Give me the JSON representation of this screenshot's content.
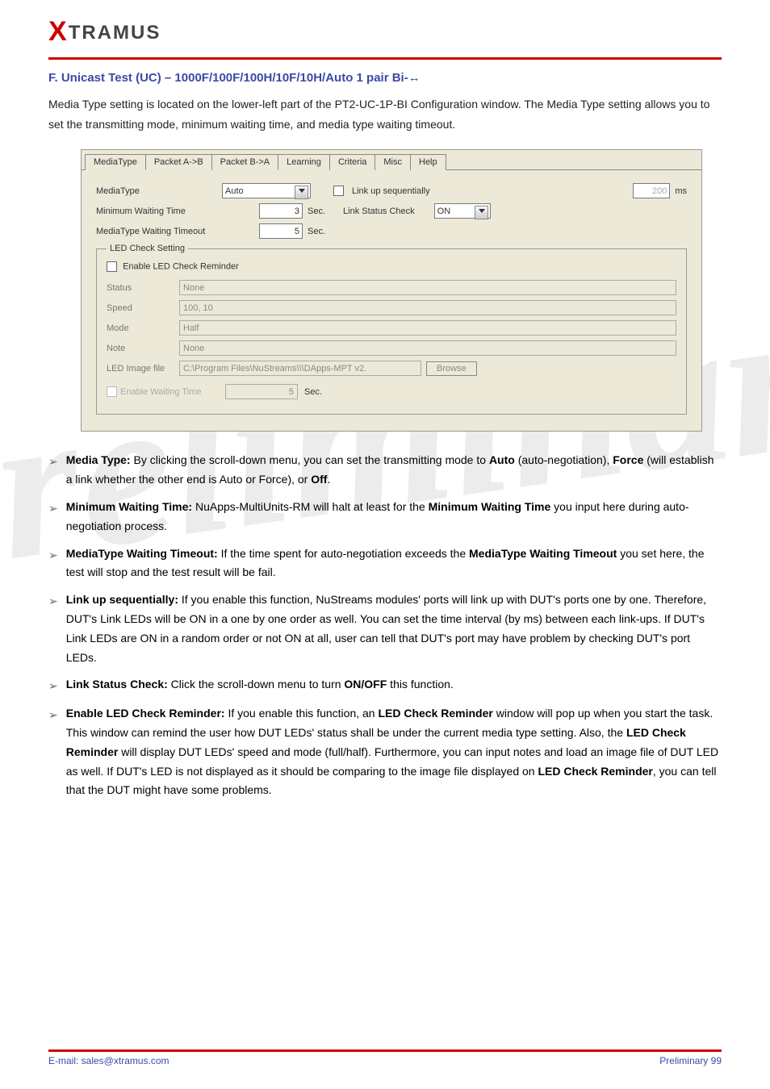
{
  "logo": {
    "x": "X",
    "rest": "TRAMUS"
  },
  "section_title_prefix": "F. Unicast Test (UC) – 1000F/100F/100H/10F/10H/Auto 1 pair Bi-",
  "section_title_arrow": "↔",
  "intro": "Media Type setting is located on the lower-left part of the PT2-UC-1P-BI Configuration window. The Media Type setting allows you to set the transmitting mode, minimum waiting time, and media type waiting timeout.",
  "tabs": [
    "MediaType",
    "Packet A->B",
    "Packet B->A",
    "Learning",
    "Criteria",
    "Misc",
    "Help"
  ],
  "mediaType": {
    "label": "MediaType",
    "value": "Auto",
    "linkup_label": "Link up sequentially",
    "linkup_value": "200",
    "linkup_unit": "ms"
  },
  "minWait": {
    "label": "Minimum Waiting Time",
    "value": "3",
    "unit": "Sec."
  },
  "linkStatus": {
    "label": "Link Status Check",
    "value": "ON"
  },
  "mtTimeout": {
    "label": "MediaType Waiting Timeout",
    "value": "5",
    "unit": "Sec."
  },
  "led": {
    "legend": "LED Check Setting",
    "enable_label": "Enable LED Check Reminder",
    "rows": {
      "status": {
        "label": "Status",
        "value": "None"
      },
      "speed": {
        "label": "Speed",
        "value": "100, 10"
      },
      "mode": {
        "label": "Mode",
        "value": "Half"
      },
      "note": {
        "label": "Note",
        "value": "None"
      },
      "image": {
        "label": "LED Image file",
        "value": "C:\\Program Files\\NuStreams\\\\\\DApps-MPT v2.",
        "button": "Browse"
      }
    },
    "ewt": {
      "label": "Enable Waiting Time",
      "value": "5",
      "unit": "Sec."
    }
  },
  "bullets": [
    "<b>Media Type:</b> By clicking the scroll-down menu, you can set the transmitting mode to <b>Auto</b> (auto-negotiation), <b>Force</b> (will establish a link whether the other end is Auto or Force), or <b>Off</b>.",
    "<b>Minimum Waiting Time:</b> NuApps-MultiUnits-RM will halt at least for the <b>Minimum Waiting Time</b> you input here during auto-negotiation process.",
    "<b>MediaType Waiting Timeout:</b> If the time spent for auto-negotiation exceeds the <b>MediaType Waiting Timeout</b> you set here, the test will stop and the test result will be fail.",
    "<b>Link up sequentially:</b> If you enable this function, NuStreams modules' ports will link up with DUT's ports one by one. Therefore, DUT's Link LEDs will be ON in a one by one order as well. You can set the time interval (by ms) between each link-ups. If DUT's Link LEDs are ON in a random order or not ON at all, user can tell that DUT's port may have problem by checking DUT's port LEDs.",
    "<b>Link Status Check:</b> Click the scroll-down menu to turn <b>ON/OFF</b> this function.",
    "<b>Enable LED Check Reminder:</b> If you enable this function, an <b>LED Check Reminder</b> window will pop up when you start the task. This window can remind the user how DUT LEDs' status shall be under the current media type setting. Also, the <b>LED Check Reminder</b> will display DUT LEDs' speed and mode (full/half). Furthermore, you can input notes and load an image file of DUT LED as well. If DUT's LED is not displayed as it should be comparing to the image file displayed on <b>LED Check Reminder</b>, you can tell that the DUT might have some problems."
  ],
  "footer": {
    "left": "E-mail: sales@xtramus.com",
    "right": "Preliminary 99"
  }
}
